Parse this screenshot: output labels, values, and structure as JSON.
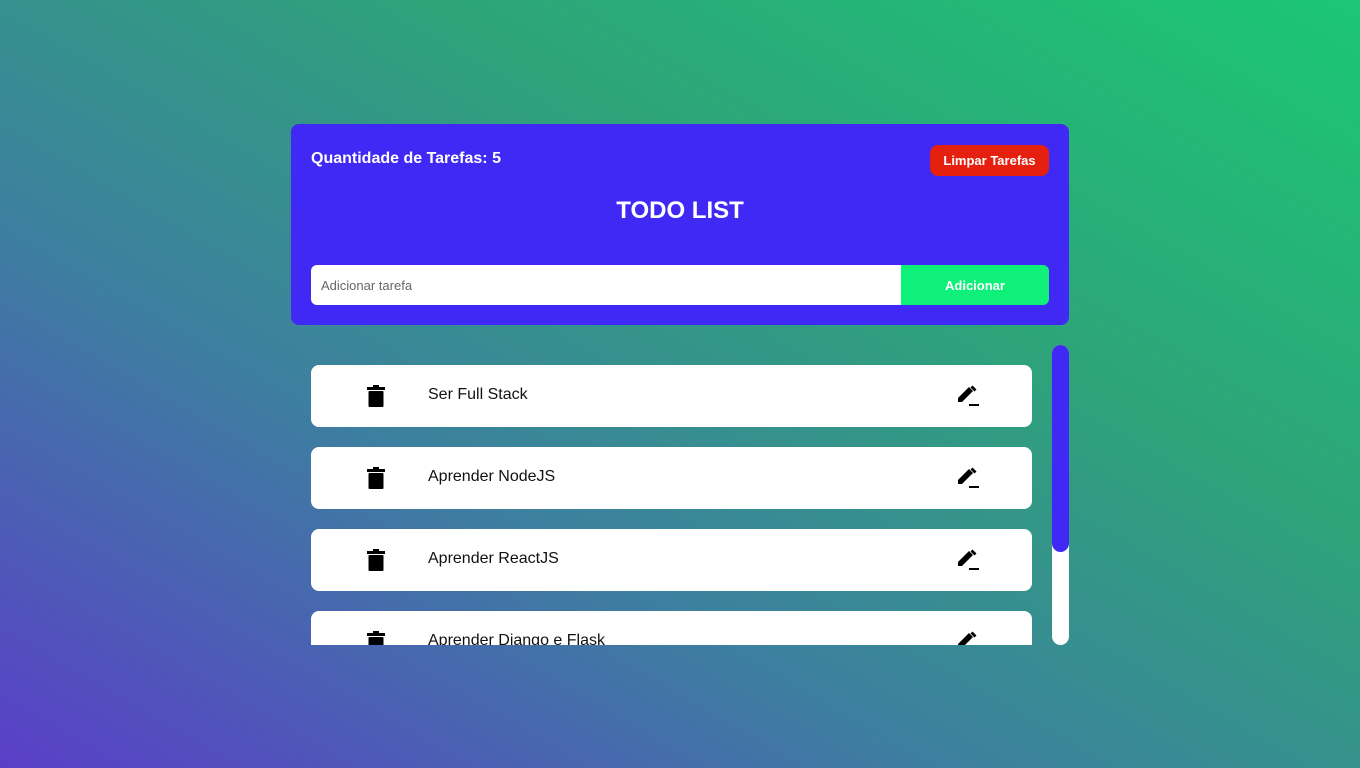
{
  "header": {
    "counter_label": "Quantidade de Tarefas: 5",
    "clear_button": "Limpar Tarefas",
    "title": "TODO LIST"
  },
  "add_form": {
    "placeholder": "Adicionar tarefa",
    "value": "",
    "button": "Adicionar"
  },
  "tasks": [
    {
      "text": "Ser Full Stack",
      "delete_icon": "trash-icon",
      "edit_icon": "pencil-icon"
    },
    {
      "text": "Aprender NodeJS",
      "delete_icon": "trash-icon",
      "edit_icon": "pencil-icon"
    },
    {
      "text": "Aprender ReactJS",
      "delete_icon": "trash-icon",
      "edit_icon": "pencil-icon"
    },
    {
      "text": "Aprender Django e Flask",
      "delete_icon": "trash-icon",
      "edit_icon": "pencil-icon"
    }
  ],
  "colors": {
    "card": "#4029f5",
    "clear_button": "#e6200f",
    "add_button": "#0ef07a",
    "scrollbar_thumb": "#4029f5"
  }
}
